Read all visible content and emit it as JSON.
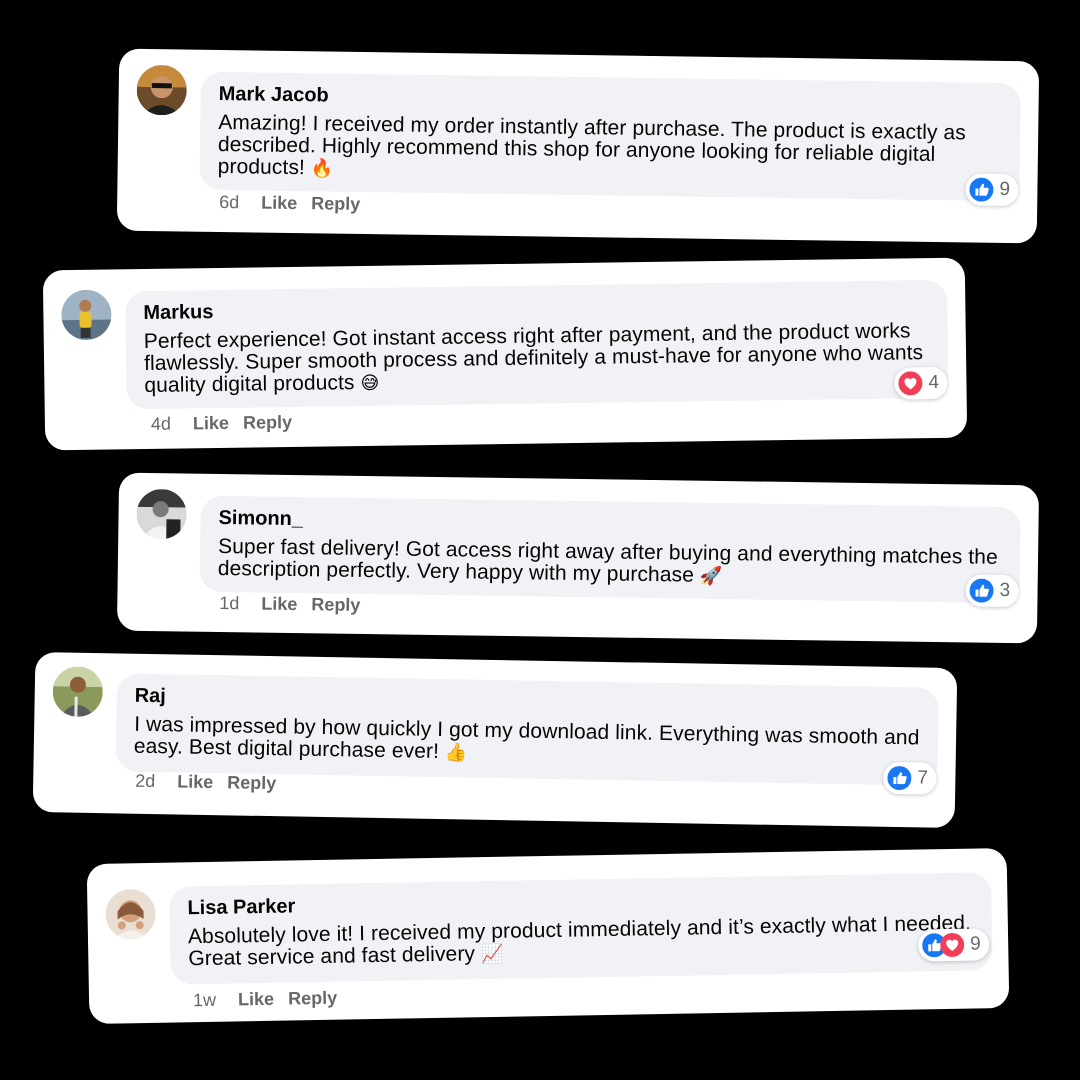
{
  "comments": [
    {
      "author": "Mark Jacob",
      "text": "Amazing! I received my order instantly after purchase. The product is exactly as described. Highly recommend this shop for anyone looking for reliable digital products!",
      "emoji": "🔥",
      "time": "6d",
      "like_label": "Like",
      "reply_label": "Reply",
      "reactions": [
        "like-icon"
      ],
      "reaction_count": "9"
    },
    {
      "author": "Markus",
      "text": "Perfect experience! Got instant access right after payment, and the product works flawlessly. Super smooth process and definitely a must-have for anyone who wants quality digital products",
      "emoji": "😅",
      "time": "4d",
      "like_label": "Like",
      "reply_label": "Reply",
      "reactions": [
        "love-icon"
      ],
      "reaction_count": "4"
    },
    {
      "author": "Simonn_",
      "text": "Super fast delivery! Got access right away after buying and everything matches the description perfectly. Very happy with my purchase",
      "emoji": "🚀",
      "time": "1d",
      "like_label": "Like",
      "reply_label": "Reply",
      "reactions": [
        "like-icon"
      ],
      "reaction_count": "3"
    },
    {
      "author": "Raj",
      "text": "I was impressed by how quickly I got my download link. Everything was smooth and easy. Best digital purchase ever!",
      "emoji": "👍",
      "time": "2d",
      "like_label": "Like",
      "reply_label": "Reply",
      "reactions": [
        "like-icon"
      ],
      "reaction_count": "7"
    },
    {
      "author": "Lisa Parker",
      "text": "Absolutely love it! I received my product immediately and it’s exactly what I needed. Great service and fast delivery",
      "emoji": "📈",
      "time": "1w",
      "like_label": "Like",
      "reply_label": "Reply",
      "reactions": [
        "like-icon",
        "love-icon"
      ],
      "reaction_count": "9"
    }
  ],
  "colors": {
    "background": "#000000",
    "card": "#ffffff",
    "bubble": "#f0f2f5",
    "like_blue": "#1877f2",
    "love_red": "#f33e58",
    "meta_gray": "#65676b"
  }
}
